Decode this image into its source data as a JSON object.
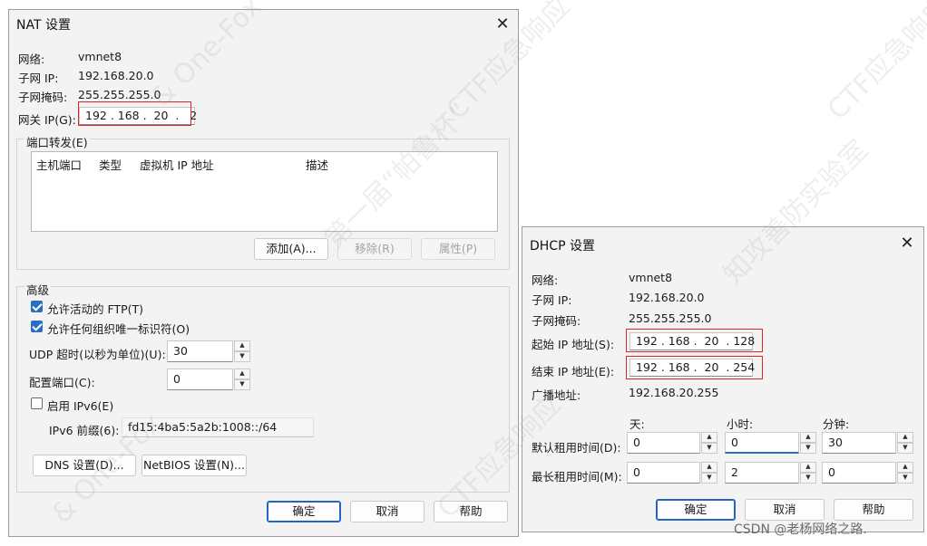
{
  "nat": {
    "title": "NAT 设置",
    "network_label": "网络:",
    "network_value": "vmnet8",
    "subnet_ip_label": "子网 IP:",
    "subnet_ip_value": "192.168.20.0",
    "subnet_mask_label": "子网掩码:",
    "subnet_mask_value": "255.255.255.0",
    "gateway_label": "网关 IP(G):",
    "gateway_value": "192 . 168 .  20  .   2",
    "port_forwarding_label": "端口转发(E)",
    "columns": [
      "主机端口",
      "类型",
      "虚拟机 IP 地址",
      "描述"
    ],
    "add_button": "添加(A)...",
    "remove_button": "移除(R)",
    "properties_button": "属性(P)",
    "advanced_label": "高级",
    "allow_ftp_label": "允许活动的 FTP(T)",
    "allow_ftp_checked": true,
    "allow_oui_label": "允许任何组织唯一标识符(O)",
    "allow_oui_checked": true,
    "udp_timeout_label": "UDP 超时(以秒为单位)(U):",
    "udp_timeout_value": "30",
    "config_port_label": "配置端口(C):",
    "config_port_value": "0",
    "enable_ipv6_label": "启用 IPv6(E)",
    "enable_ipv6_checked": false,
    "ipv6_prefix_label": "IPv6 前缀(6):",
    "ipv6_prefix_value": "fd15:4ba5:5a2b:1008::/64",
    "dns_button": "DNS 设置(D)...",
    "netbios_button": "NetBIOS 设置(N)...",
    "ok_button": "确定",
    "cancel_button": "取消",
    "help_button": "帮助"
  },
  "dhcp": {
    "title": "DHCP 设置",
    "network_label": "网络:",
    "network_value": "vmnet8",
    "subnet_ip_label": "子网 IP:",
    "subnet_ip_value": "192.168.20.0",
    "subnet_mask_label": "子网掩码:",
    "subnet_mask_value": "255.255.255.0",
    "start_ip_label": "起始 IP 地址(S):",
    "start_ip_value": "192 . 168 .  20  . 128",
    "end_ip_label": "结束 IP 地址(E):",
    "end_ip_value": "192 . 168 .  20  . 254",
    "broadcast_label": "广播地址:",
    "broadcast_value": "192.168.20.255",
    "days_label": "天:",
    "hours_label": "小时:",
    "minutes_label": "分钟:",
    "default_lease_label": "默认租用时间(D):",
    "default_days": "0",
    "default_hours": "0",
    "default_minutes": "30",
    "max_lease_label": "最长租用时间(M):",
    "max_days": "0",
    "max_hours": "2",
    "max_minutes": "0",
    "ok_button": "确定",
    "cancel_button": "取消",
    "help_button": "帮助"
  },
  "watermark": {
    "line1": "CTF应急响应",
    "line2": "& One-Fox",
    "line3": "第一届“帕鲁杯”",
    "line4": "知攻善防实验室",
    "credit": "CSDN @老杨网络之路."
  }
}
